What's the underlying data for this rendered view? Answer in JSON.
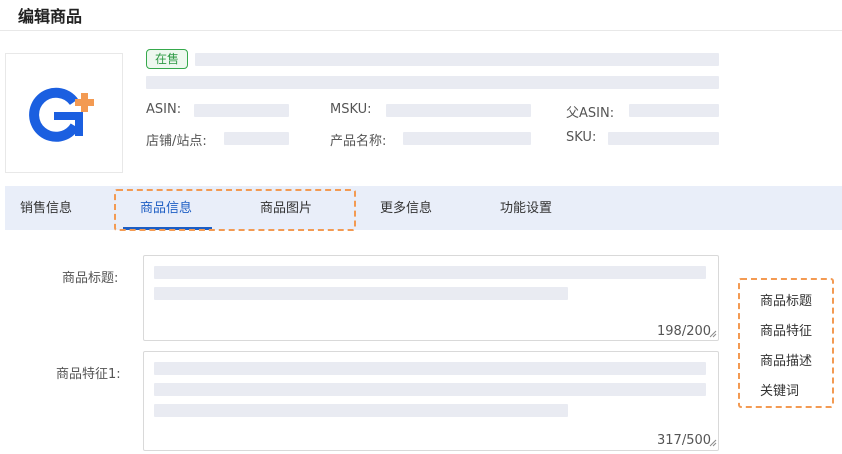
{
  "page": {
    "title": "编辑商品"
  },
  "product": {
    "status": "在售",
    "meta_labels": {
      "asin": "ASIN:",
      "msku": "MSKU:",
      "parent_asin": "父ASIN:",
      "store_site": "店铺/站点:",
      "product_name": "产品名称:",
      "sku": "SKU:"
    }
  },
  "tabs": [
    {
      "label": "销售信息"
    },
    {
      "label": "商品信息"
    },
    {
      "label": "商品图片"
    },
    {
      "label": "更多信息"
    },
    {
      "label": "功能设置"
    }
  ],
  "active_tab": "商品信息",
  "form": {
    "title_field": {
      "label": "商品标题:",
      "count": "198/200"
    },
    "feature1_field": {
      "label": "商品特征1:",
      "count": "317/500"
    }
  },
  "side_menu": {
    "items": [
      {
        "label": "商品标题"
      },
      {
        "label": "商品特征"
      },
      {
        "label": "商品描述"
      },
      {
        "label": "关键词"
      }
    ]
  },
  "colors": {
    "accent": "#1f5fc4",
    "logo_blue": "#1b5fe0",
    "logo_orange": "#f39a52",
    "status_green": "#36a94c",
    "highlight_dash": "#f39a52",
    "tab_bar_bg": "#e9eef9"
  }
}
